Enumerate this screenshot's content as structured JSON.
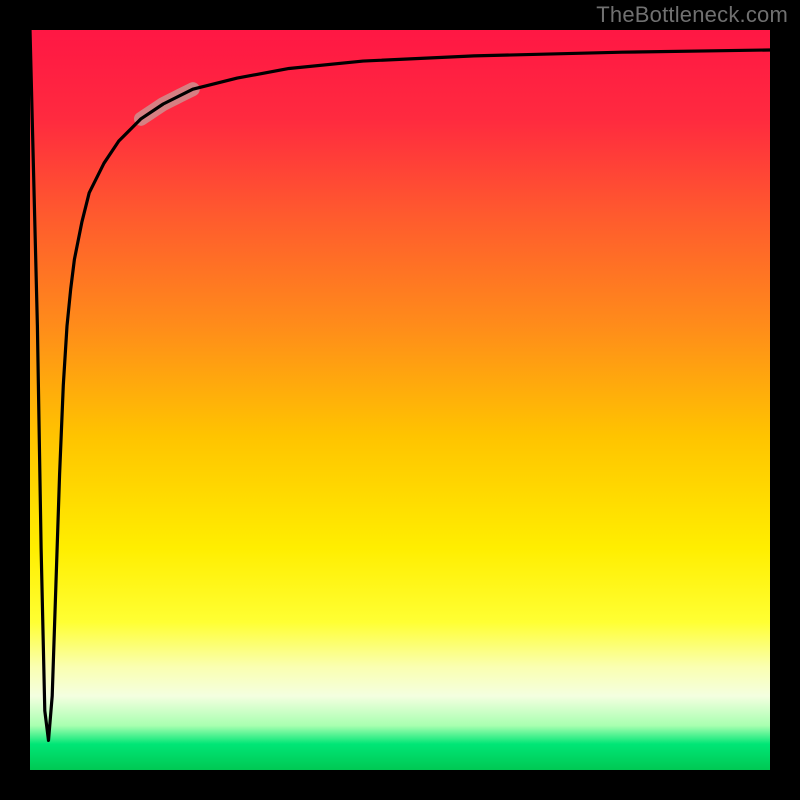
{
  "attribution": "TheBottleneck.com",
  "gradient": {
    "stops": [
      {
        "offset": 0.0,
        "color": "#ff1744"
      },
      {
        "offset": 0.12,
        "color": "#ff2a3f"
      },
      {
        "offset": 0.25,
        "color": "#ff5a2e"
      },
      {
        "offset": 0.4,
        "color": "#ff8c1a"
      },
      {
        "offset": 0.55,
        "color": "#ffc400"
      },
      {
        "offset": 0.7,
        "color": "#ffee00"
      },
      {
        "offset": 0.8,
        "color": "#ffff33"
      },
      {
        "offset": 0.86,
        "color": "#faffb0"
      },
      {
        "offset": 0.9,
        "color": "#f4ffe0"
      },
      {
        "offset": 0.94,
        "color": "#a8ffb0"
      },
      {
        "offset": 0.965,
        "color": "#00e676"
      },
      {
        "offset": 1.0,
        "color": "#00c853"
      }
    ]
  },
  "chart_data": {
    "type": "line",
    "title": "",
    "xlabel": "",
    "ylabel": "",
    "xlim": [
      0,
      100
    ],
    "ylim": [
      0,
      100
    ],
    "series": [
      {
        "name": "bottleneck-curve",
        "x": [
          0,
          1,
          1.5,
          2,
          2.5,
          3,
          3.5,
          4,
          4.5,
          5,
          5.5,
          6,
          7,
          8,
          10,
          12,
          15,
          18,
          22,
          28,
          35,
          45,
          60,
          80,
          100
        ],
        "y": [
          100,
          60,
          30,
          8,
          4,
          10,
          25,
          40,
          52,
          60,
          65,
          69,
          74,
          78,
          82,
          85,
          88,
          90,
          92,
          93.5,
          94.8,
          95.8,
          96.5,
          97,
          97.3
        ]
      }
    ],
    "highlight": {
      "series": "bottleneck-curve",
      "x_start": 15,
      "x_end": 22,
      "color": "#cf8f8f",
      "width": 14
    }
  }
}
